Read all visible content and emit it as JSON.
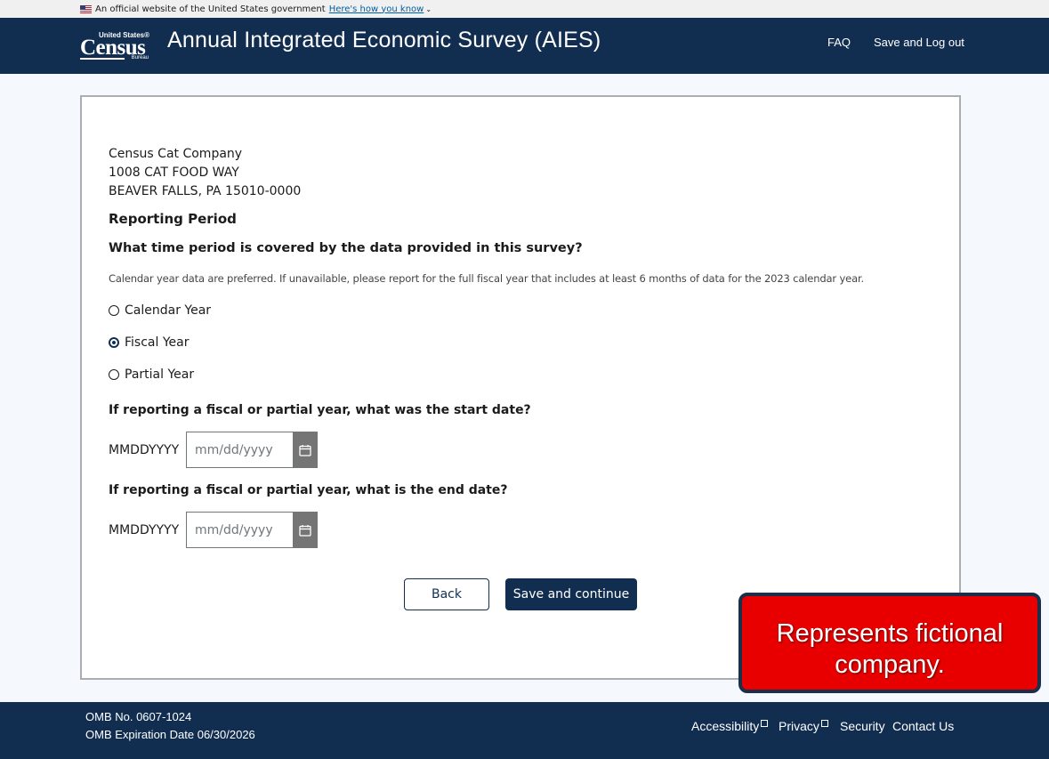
{
  "gov_banner": {
    "text": "An official website of the United States government",
    "link": "Here's how you know"
  },
  "header": {
    "logo": {
      "top": "United States®",
      "word": "Census",
      "bottom": "Bureau"
    },
    "title": "Annual Integrated Economic Survey (AIES)",
    "nav": {
      "faq": "FAQ",
      "logout": "Save and Log out"
    }
  },
  "company": {
    "name": "Census Cat Company",
    "street": "1008 CAT FOOD WAY",
    "city": "BEAVER FALLS, PA 15010-0000"
  },
  "form": {
    "section_title": "Reporting Period",
    "question": "What time period is covered by the data provided in this survey?",
    "hint": "Calendar year data are preferred. If unavailable, please report for the full fiscal year that includes at least 6 months of data for the 2023 calendar year.",
    "options": [
      {
        "label": "Calendar Year",
        "selected": false
      },
      {
        "label": "Fiscal Year",
        "selected": true
      },
      {
        "label": "Partial Year",
        "selected": false
      }
    ],
    "start": {
      "q_prefix": "If reporting a fiscal or partial year, what was the ",
      "q_bold": "start",
      "q_suffix": " date?",
      "label": "MMDDYYYY",
      "placeholder": "mm/dd/yyyy"
    },
    "end": {
      "q_prefix": "If reporting a fiscal or partial year, what is the ",
      "q_bold": "end",
      "q_suffix": " date?",
      "label": "MMDDYYYY",
      "placeholder": "mm/dd/yyyy"
    },
    "back_label": "Back",
    "save_label": "Save and continue"
  },
  "callout": {
    "line1": "Represents fictional",
    "line2": "company."
  },
  "footer": {
    "omb_no": "OMB No. 0607-1024",
    "omb_exp": "OMB Expiration Date 06/30/2026",
    "links": {
      "accessibility": "Accessibility",
      "privacy": "Privacy",
      "security": "Security",
      "contact": "Contact Us"
    }
  },
  "colors": {
    "navy": "#112e51",
    "callout_red": "#e80000",
    "link_blue": "#005ea2"
  }
}
